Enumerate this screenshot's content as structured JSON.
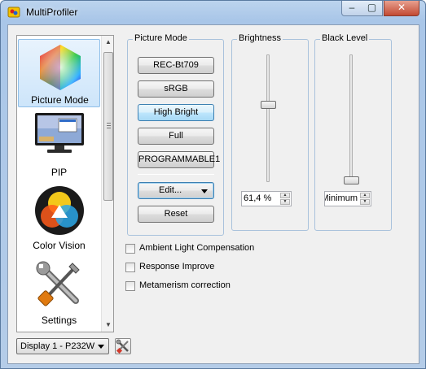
{
  "window": {
    "title": "MultiProfiler",
    "min_glyph": "–",
    "max_glyph": "▢",
    "close_glyph": "✕"
  },
  "sidebar": {
    "items": [
      {
        "label": "Picture Mode",
        "icon": "color-hexagon-icon",
        "selected": true
      },
      {
        "label": "PIP",
        "icon": "monitor-icon",
        "selected": false
      },
      {
        "label": "Color Vision",
        "icon": "color-vision-icon",
        "selected": false
      },
      {
        "label": "Settings",
        "icon": "tools-icon",
        "selected": false
      }
    ],
    "scroll_up": "▲",
    "scroll_down": "▼"
  },
  "picture_mode": {
    "title": "Picture Mode",
    "buttons": [
      "REC-Bt709",
      "sRGB",
      "High Bright",
      "Full",
      "PROGRAMMABLE1"
    ],
    "active_button": "High Bright",
    "edit_label": "Edit...",
    "reset_label": "Reset"
  },
  "brightness": {
    "title": "Brightness",
    "value": "61,4 %",
    "level_percent": 61.4
  },
  "black_level": {
    "title": "Black Level",
    "value": "Minimum"
  },
  "options": [
    {
      "label": "Ambient Light Compensation",
      "checked": false
    },
    {
      "label": "Response Improve",
      "checked": false
    },
    {
      "label": "Metamerism correction",
      "checked": false
    }
  ],
  "display_select": {
    "value": "Display 1 - P232W"
  },
  "colors": {
    "accent": "#3c7fb1",
    "selection_bg": "#cde5fa",
    "frame": "#a9c6e8"
  }
}
